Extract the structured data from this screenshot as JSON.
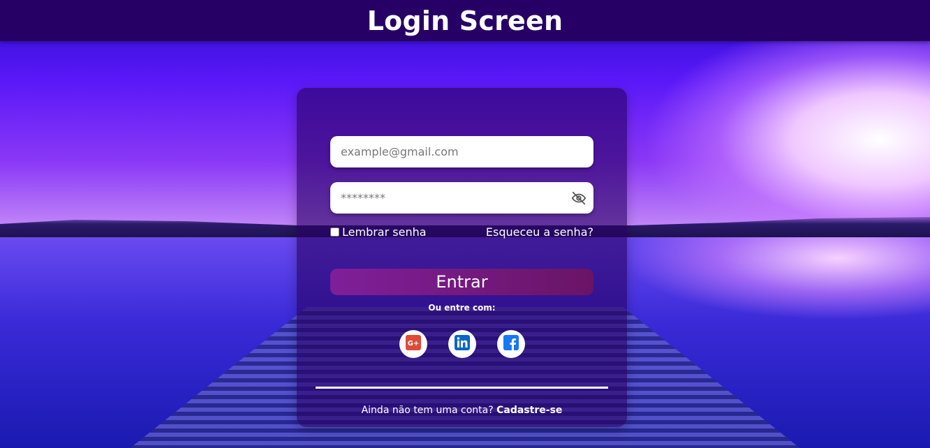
{
  "header": {
    "title": "Login Screen"
  },
  "form": {
    "email_placeholder": "example@gmail.com",
    "password_placeholder": "********",
    "remember_label": "Lembrar senha",
    "forgot_label": "Esqueceu a senha?",
    "submit_label": "Entrar",
    "or_label": "Ou entre com:",
    "signup_prompt": "Ainda não tem uma conta?",
    "signup_link": "Cadastre-se"
  },
  "socials": [
    {
      "name": "google-plus-icon",
      "color": "#dd4b39"
    },
    {
      "name": "linkedin-icon",
      "color": "#0a66c2"
    },
    {
      "name": "facebook-icon",
      "color": "#1877f2"
    }
  ],
  "colors": {
    "header_bg": "#270066",
    "button_start": "#7f1f9a",
    "button_end": "#6a1466"
  }
}
